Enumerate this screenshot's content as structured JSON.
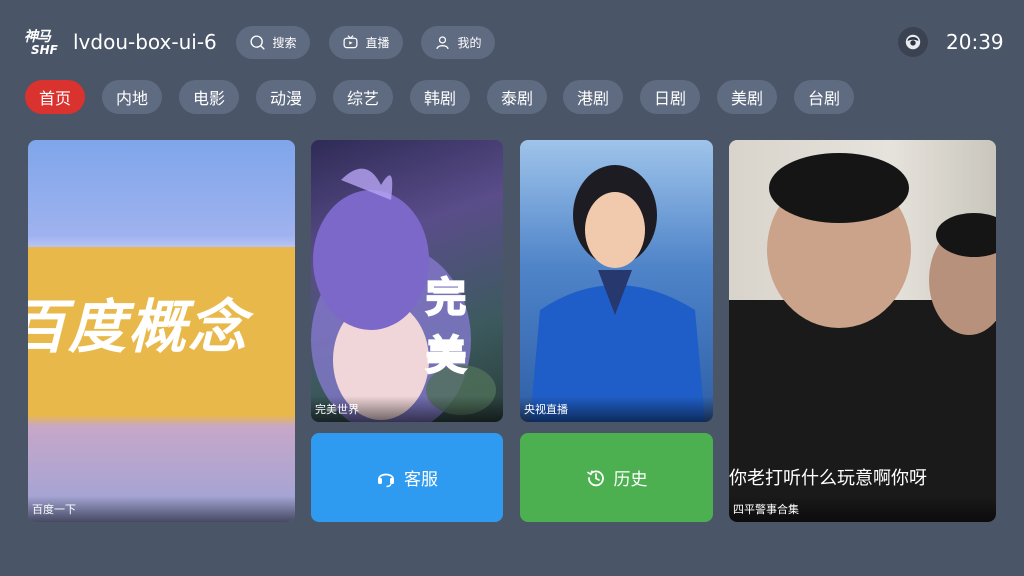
{
  "header": {
    "logo_line1": "神马",
    "logo_line2": "SHF",
    "title": "lvdou-box-ui-6",
    "search_label": "搜索",
    "live_label": "直播",
    "mine_label": "我的",
    "time": "20:39"
  },
  "tabs": [
    "首页",
    "内地",
    "电影",
    "动漫",
    "综艺",
    "韩剧",
    "泰剧",
    "港剧",
    "日剧",
    "美剧",
    "台剧"
  ],
  "active_tab": "首页",
  "cards": {
    "baidu": {
      "caption": "百度一下",
      "poster_text": "百度概念"
    },
    "wanmei": {
      "caption": "完美世界",
      "poster_text": "完美"
    },
    "cctv": {
      "caption": "央视直播"
    },
    "siping": {
      "caption": "四平警事合集",
      "subtitle": "你老打听什么玩意啊你呀"
    }
  },
  "actions": {
    "service_label": "客服",
    "history_label": "历史"
  },
  "colors": {
    "background": "#4a5568",
    "tab_active": "#d9322f",
    "service_button": "#2f9bf0",
    "history_button": "#4caf50"
  }
}
